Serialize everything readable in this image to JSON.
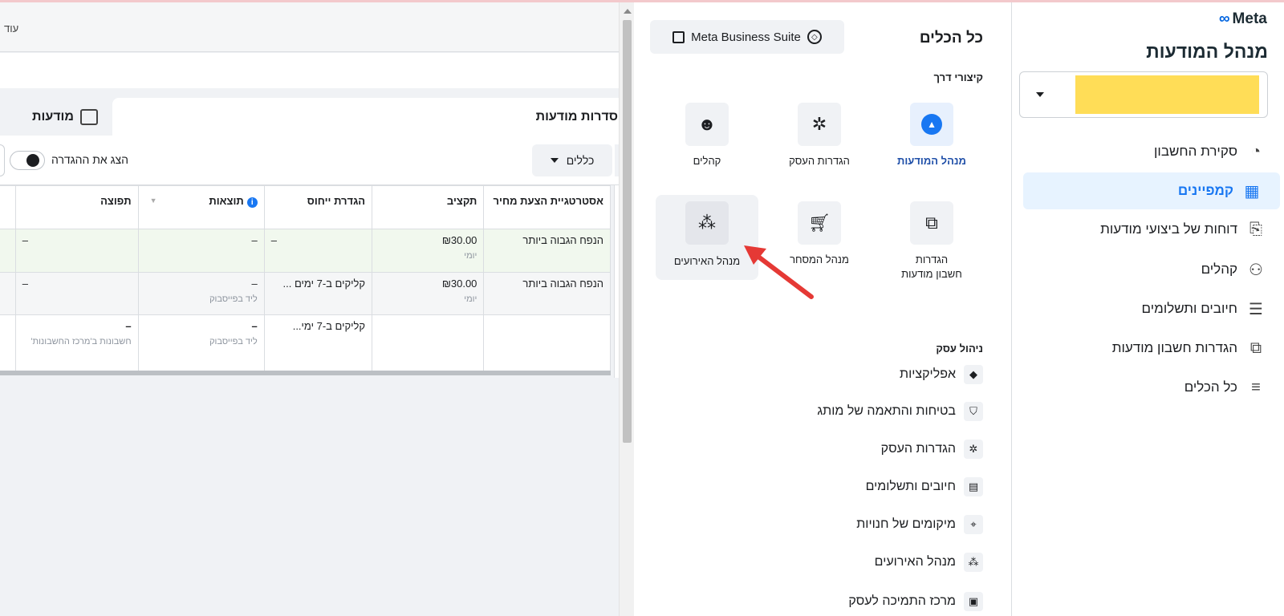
{
  "brand": {
    "logo_text": "Meta",
    "logo_symbol": "∞"
  },
  "sidebar": {
    "title": "מנהל המודעות",
    "account_selector": {
      "value": ""
    },
    "items": [
      {
        "label": "סקירת החשבון",
        "icon": "dashboard-gauge-icon",
        "active": false
      },
      {
        "label": "קמפיינים",
        "icon": "table-grid-icon",
        "active": true
      },
      {
        "label": "דוחות של ביצועי מודעות",
        "icon": "reports-icon",
        "active": false
      },
      {
        "label": "קהלים",
        "icon": "audiences-icon",
        "active": false
      },
      {
        "label": "חיובים ותשלומים",
        "icon": "billing-icon",
        "active": false
      },
      {
        "label": "הגדרות חשבון מודעות",
        "icon": "ad-account-settings-icon",
        "active": false
      },
      {
        "label": "כל הכלים",
        "icon": "hamburger-menu-icon",
        "active": false
      }
    ]
  },
  "tools_panel": {
    "title": "כל הכלים",
    "mbs_button": "Meta Business Suite",
    "shortcuts_heading": "קיצורי דרך",
    "shortcuts": [
      {
        "label": "מנהל המודעות",
        "icon": "ads-manager-icon"
      },
      {
        "label": "הגדרות העסק",
        "icon": "gear-icon"
      },
      {
        "label": "קהלים",
        "icon": "people-icon"
      },
      {
        "label": "הגדרות חשבון מודעות",
        "icon": "ad-account-settings-icon"
      },
      {
        "label": "מנהל המסחר",
        "icon": "shopping-cart-icon"
      },
      {
        "label": "מנהל האירועים",
        "icon": "events-manager-icon"
      }
    ],
    "business_heading": "ניהול עסק",
    "business_items": [
      {
        "label": "אפליקציות",
        "icon": "cube-icon"
      },
      {
        "label": "בטיחות והתאמה של מותג",
        "icon": "shield-icon"
      },
      {
        "label": "הגדרות העסק",
        "icon": "gear-icon"
      },
      {
        "label": "חיובים ותשלומים",
        "icon": "billing-icon"
      },
      {
        "label": "מיקומים של חנויות",
        "icon": "map-pin-icon"
      },
      {
        "label": "מנהל האירועים",
        "icon": "events-manager-icon"
      },
      {
        "label": "מרכז התמיכה לעסק",
        "icon": "support-icon"
      }
    ]
  },
  "ads_manager": {
    "more_text": "עוד",
    "tab_adsets": "סדרות מודעות",
    "tab_ads": "מודעות",
    "rules_button": "כללים",
    "toggle_label": "הצג את ההגדרה",
    "columns": [
      "אסטרטגיית הצעת מחיר",
      "תקציב",
      "הגדרת ייחוס",
      "תוצאות",
      "תפוצה"
    ],
    "rows": [
      {
        "bid": "הנפח הגבוה ביותר",
        "budget": "₪30.00",
        "budget_sub": "יומי",
        "attribution": "–",
        "results": "–",
        "results_sub": "",
        "reach": "–"
      },
      {
        "bid": "הנפח הגבוה ביותר",
        "budget": "₪30.00",
        "budget_sub": "יומי",
        "attribution": "קליקים ב-7 ימים ...",
        "results": "–",
        "results_sub": "ליד בפייסבוק",
        "reach": "–"
      },
      {
        "bid": "",
        "budget": "",
        "budget_sub": "",
        "attribution": "קליקים ב-7 ימי...",
        "results": "–",
        "results_sub": "ליד בפייסבוק",
        "reach": "–",
        "reach_sub": "חשבונות ב'מרכז החשבונות'"
      }
    ]
  }
}
